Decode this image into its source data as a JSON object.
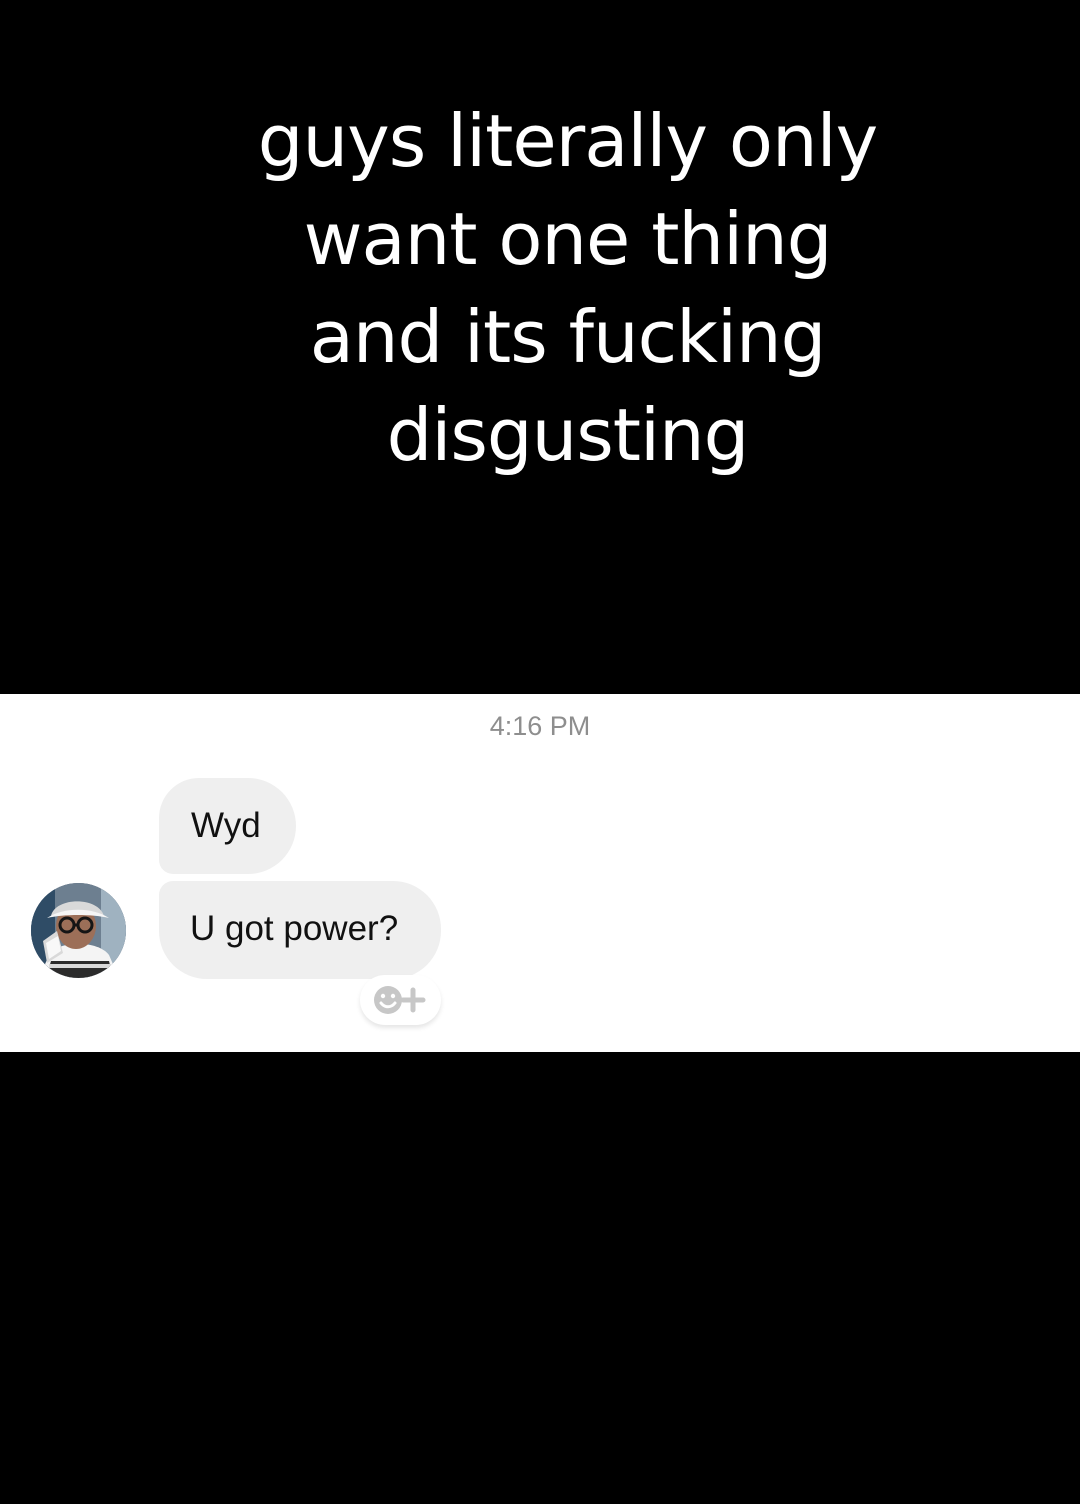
{
  "meme": {
    "caption": "guys literally only\nwant one thing\nand its fucking\ndisgusting"
  },
  "chat": {
    "timestamp": "4:16 PM",
    "messages": [
      {
        "text": "Wyd"
      },
      {
        "text": "U got power?"
      }
    ],
    "reaction_icon": "emoji-plus-icon",
    "avatar_icon": "profile-avatar"
  },
  "colors": {
    "background": "#000000",
    "chat_background": "#ffffff",
    "incoming_bubble": "#efefef",
    "timestamp": "#8e8e8e",
    "reaction_icon": "#c7c7c7"
  }
}
